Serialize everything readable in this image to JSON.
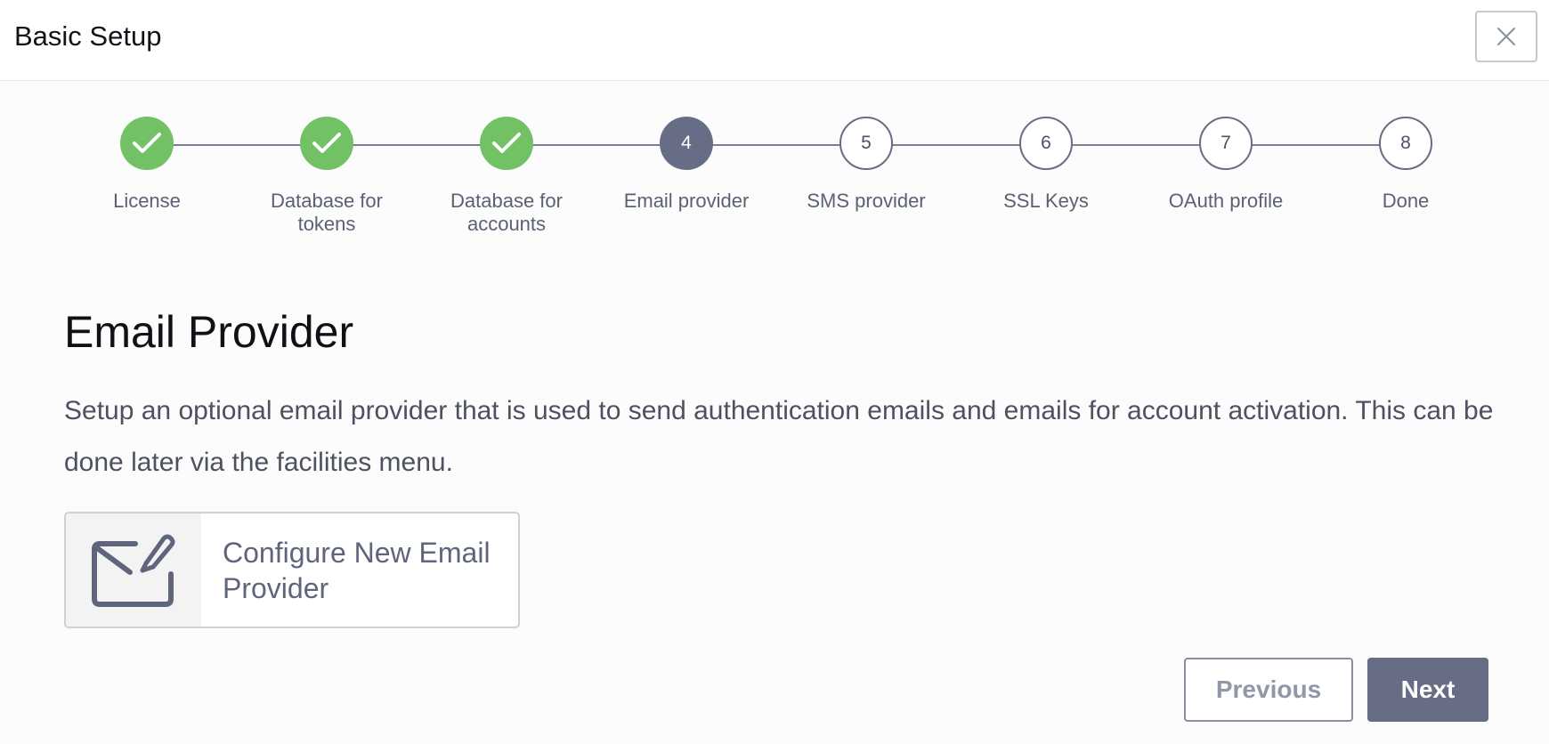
{
  "header": {
    "title": "Basic Setup",
    "close_icon": "close-icon"
  },
  "stepper": {
    "steps": [
      {
        "number": "1",
        "label": "License",
        "state": "done"
      },
      {
        "number": "2",
        "label": "Database for tokens",
        "state": "done"
      },
      {
        "number": "3",
        "label": "Database for accounts",
        "state": "done"
      },
      {
        "number": "4",
        "label": "Email provider",
        "state": "active"
      },
      {
        "number": "5",
        "label": "SMS provider",
        "state": "pending"
      },
      {
        "number": "6",
        "label": "SSL Keys",
        "state": "pending"
      },
      {
        "number": "7",
        "label": "OAuth profile",
        "state": "pending"
      },
      {
        "number": "8",
        "label": "Done",
        "state": "pending"
      }
    ]
  },
  "main": {
    "title": "Email Provider",
    "description": "Setup an optional email provider that is used to send authentication emails and emails for account activation. This can be done later via the facilities menu.",
    "configure_card": {
      "label": "Configure New Email Provider",
      "icon": "email-edit-icon"
    }
  },
  "footer": {
    "previous_label": "Previous",
    "next_label": "Next"
  },
  "colors": {
    "done": "#72c265",
    "active": "#666d85",
    "line": "#7b7f8f"
  }
}
